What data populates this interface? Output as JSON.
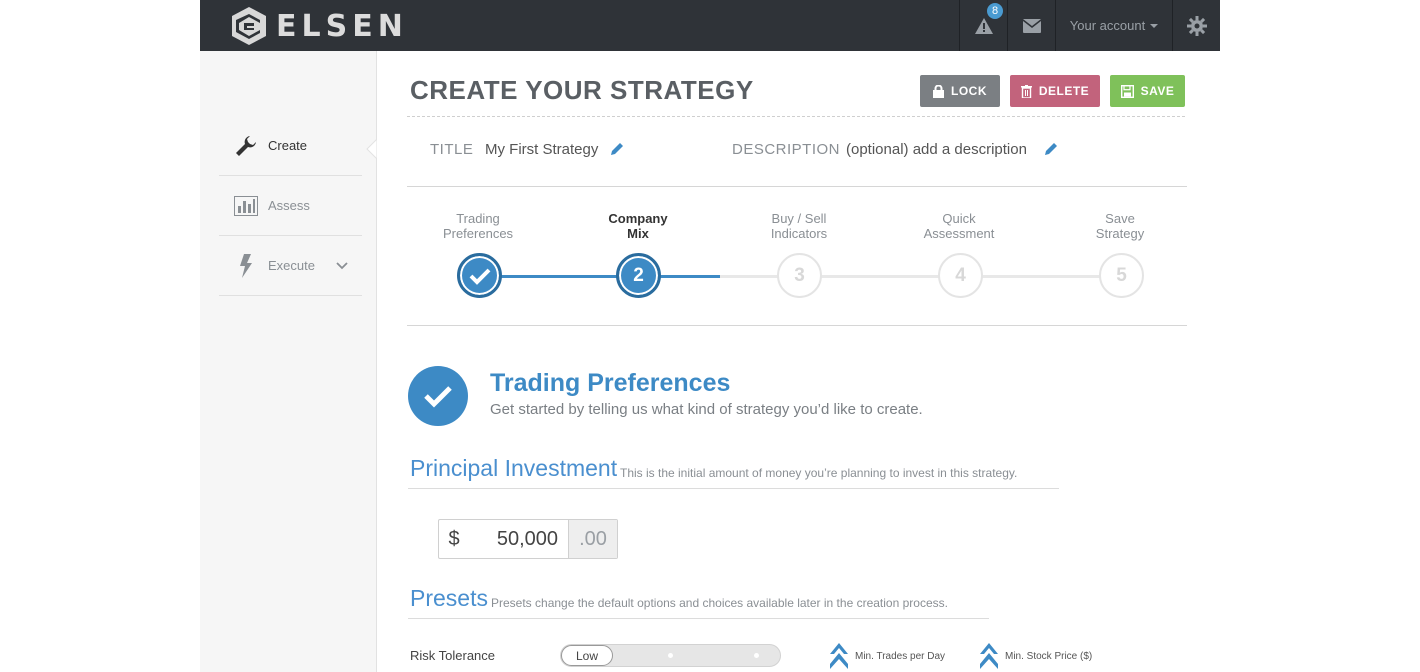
{
  "brand": {
    "name": "ELSEN"
  },
  "topnav": {
    "alert_count": "8",
    "account_label": "Your account"
  },
  "sidebar": {
    "items": [
      {
        "label": "Create",
        "icon": "wrench-icon",
        "active": true
      },
      {
        "label": "Assess",
        "icon": "bar-chart-icon",
        "active": false
      },
      {
        "label": "Execute",
        "icon": "lightning-icon",
        "active": false
      }
    ]
  },
  "header": {
    "title": "CREATE YOUR STRATEGY",
    "lock_label": "LOCK",
    "delete_label": "DELETE",
    "save_label": "SAVE"
  },
  "meta": {
    "title_label": "TITLE",
    "title_value": "My First Strategy",
    "description_label": "DESCRIPTION",
    "description_value": "(optional) add a description"
  },
  "steps": [
    {
      "line1": "Trading",
      "line2": "Preferences",
      "number": "1",
      "state": "done"
    },
    {
      "line1": "Company",
      "line2": "Mix",
      "number": "2",
      "state": "current"
    },
    {
      "line1": "Buy / Sell",
      "line2": "Indicators",
      "number": "3",
      "state": "todo"
    },
    {
      "line1": "Quick",
      "line2": "Assessment",
      "number": "4",
      "state": "todo"
    },
    {
      "line1": "Save",
      "line2": "Strategy",
      "number": "5",
      "state": "todo"
    }
  ],
  "section": {
    "title": "Trading Preferences",
    "subtitle": "Get started by telling us what kind of strategy you’d like to create."
  },
  "principal": {
    "heading": "Principal Investment",
    "note": "This is the initial amount of money you’re planning to invest in this strategy.",
    "currency": "$",
    "amount": "50,000",
    "cents": ".00"
  },
  "presets": {
    "heading": "Presets",
    "note": "Presets change the default options and choices available later in the creation process.",
    "risk_label": "Risk Tolerance",
    "risk_value": "Low",
    "stat1_label": "Min. Trades per Day",
    "stat2_label": "Min. Stock Price ($)"
  },
  "colors": {
    "accent": "#3d8ac5",
    "topbar": "#2f3338",
    "lock": "#7b7f83",
    "delete": "#c2637c",
    "save": "#7fc15a"
  }
}
